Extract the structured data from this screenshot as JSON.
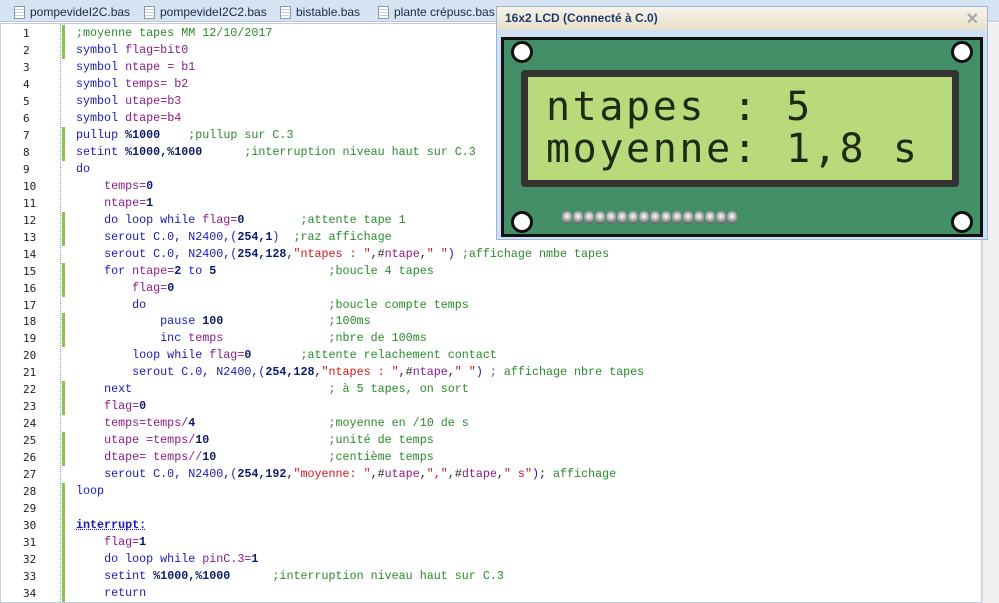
{
  "tabs": [
    {
      "label": "pompevideI2C.bas"
    },
    {
      "label": "pompevideI2C2.bas"
    },
    {
      "label": "bistable.bas"
    },
    {
      "label": "plante crépusc.bas"
    }
  ],
  "editor": {
    "lines": [
      {
        "n": "1",
        "changed": true,
        "t": [
          [
            "c",
            ";moyenne tapes MM 12/10/2017"
          ]
        ]
      },
      {
        "n": "2",
        "changed": true,
        "t": [
          [
            "k",
            "symbol "
          ],
          [
            "v",
            "flag=bit0"
          ]
        ]
      },
      {
        "n": "3",
        "t": [
          [
            "k",
            "symbol "
          ],
          [
            "v",
            "ntape = b1"
          ]
        ]
      },
      {
        "n": "4",
        "t": [
          [
            "k",
            "symbol "
          ],
          [
            "v",
            "temps= b2"
          ]
        ]
      },
      {
        "n": "5",
        "t": [
          [
            "k",
            "symbol "
          ],
          [
            "v",
            "utape=b3"
          ]
        ]
      },
      {
        "n": "6",
        "t": [
          [
            "k",
            "symbol "
          ],
          [
            "v",
            "dtape=b4"
          ]
        ]
      },
      {
        "n": "7",
        "changed": true,
        "t": [
          [
            "k",
            "pullup "
          ],
          [
            "n",
            "%1000"
          ],
          [
            "p",
            "    "
          ],
          [
            "c",
            ";pullup sur C.3"
          ]
        ]
      },
      {
        "n": "8",
        "changed": true,
        "t": [
          [
            "k",
            "setint "
          ],
          [
            "n",
            "%1000,%1000"
          ],
          [
            "p",
            "      "
          ],
          [
            "c",
            ";interruption niveau haut sur C.3"
          ]
        ]
      },
      {
        "n": "9",
        "t": [
          [
            "k",
            "do"
          ]
        ]
      },
      {
        "n": "10",
        "t": [
          [
            "p",
            "    "
          ],
          [
            "v",
            "temps="
          ],
          [
            "n",
            "0"
          ]
        ]
      },
      {
        "n": "11",
        "t": [
          [
            "p",
            "    "
          ],
          [
            "v",
            "ntape="
          ],
          [
            "n",
            "1"
          ]
        ]
      },
      {
        "n": "12",
        "changed": true,
        "t": [
          [
            "p",
            "    "
          ],
          [
            "k",
            "do loop while "
          ],
          [
            "v",
            "flag="
          ],
          [
            "n",
            "0"
          ],
          [
            "p",
            "        "
          ],
          [
            "c",
            ";attente tape 1"
          ]
        ]
      },
      {
        "n": "13",
        "changed": true,
        "t": [
          [
            "p",
            "    "
          ],
          [
            "k",
            "serout C.0, N2400,("
          ],
          [
            "n",
            "254,1"
          ],
          [
            "k",
            ")"
          ],
          [
            "p",
            "  "
          ],
          [
            "c",
            ";raz affichage"
          ]
        ]
      },
      {
        "n": "14",
        "t": [
          [
            "p",
            "    "
          ],
          [
            "k",
            "serout C.0, N2400,("
          ],
          [
            "n",
            "254,128"
          ],
          [
            "p",
            ","
          ],
          [
            "s",
            "\"ntapes : \""
          ],
          [
            "p",
            ",#"
          ],
          [
            "v",
            "ntape"
          ],
          [
            "p",
            ","
          ],
          [
            "s",
            "\" \""
          ],
          [
            "k",
            ")"
          ],
          [
            "p",
            " "
          ],
          [
            "c",
            ";affichage nmbe tapes"
          ]
        ]
      },
      {
        "n": "15",
        "changed": true,
        "t": [
          [
            "p",
            "    "
          ],
          [
            "k",
            "for "
          ],
          [
            "v",
            "ntape="
          ],
          [
            "n",
            "2"
          ],
          [
            "k",
            " to "
          ],
          [
            "n",
            "5"
          ],
          [
            "p",
            "                "
          ],
          [
            "c",
            ";boucle 4 tapes"
          ]
        ]
      },
      {
        "n": "16",
        "changed": true,
        "t": [
          [
            "p",
            "        "
          ],
          [
            "v",
            "flag="
          ],
          [
            "n",
            "0"
          ]
        ]
      },
      {
        "n": "17",
        "t": [
          [
            "p",
            "        "
          ],
          [
            "k",
            "do"
          ],
          [
            "p",
            "                          "
          ],
          [
            "c",
            ";boucle compte temps"
          ]
        ]
      },
      {
        "n": "18",
        "changed": true,
        "t": [
          [
            "p",
            "            "
          ],
          [
            "k",
            "pause "
          ],
          [
            "n",
            "100"
          ],
          [
            "p",
            "               "
          ],
          [
            "c",
            ";100ms"
          ]
        ]
      },
      {
        "n": "19",
        "changed": true,
        "t": [
          [
            "p",
            "            "
          ],
          [
            "k",
            "inc "
          ],
          [
            "v",
            "temps"
          ],
          [
            "p",
            "               "
          ],
          [
            "c",
            ";nbre de 100ms"
          ]
        ]
      },
      {
        "n": "20",
        "t": [
          [
            "p",
            "        "
          ],
          [
            "k",
            "loop while "
          ],
          [
            "v",
            "flag="
          ],
          [
            "n",
            "0"
          ],
          [
            "p",
            "       "
          ],
          [
            "c",
            ";attente relachement contact"
          ]
        ]
      },
      {
        "n": "21",
        "t": [
          [
            "p",
            "        "
          ],
          [
            "k",
            "serout C.0, N2400,("
          ],
          [
            "n",
            "254,128"
          ],
          [
            "p",
            ","
          ],
          [
            "s",
            "\"ntapes : \""
          ],
          [
            "p",
            ",#"
          ],
          [
            "v",
            "ntape"
          ],
          [
            "p",
            ","
          ],
          [
            "s",
            "\" \""
          ],
          [
            "k",
            ")"
          ],
          [
            "p",
            " "
          ],
          [
            "c",
            "; affichage nbre tapes"
          ]
        ]
      },
      {
        "n": "22",
        "changed": true,
        "t": [
          [
            "p",
            "    "
          ],
          [
            "k",
            "next"
          ],
          [
            "p",
            "                            "
          ],
          [
            "c",
            "; à 5 tapes, on sort"
          ]
        ]
      },
      {
        "n": "23",
        "changed": true,
        "t": [
          [
            "p",
            "    "
          ],
          [
            "v",
            "flag="
          ],
          [
            "n",
            "0"
          ]
        ]
      },
      {
        "n": "24",
        "t": [
          [
            "p",
            "    "
          ],
          [
            "v",
            "temps=temps/"
          ],
          [
            "n",
            "4"
          ],
          [
            "p",
            "                   "
          ],
          [
            "c",
            ";moyenne en /10 de s"
          ]
        ]
      },
      {
        "n": "25",
        "changed": true,
        "t": [
          [
            "p",
            "    "
          ],
          [
            "v",
            "utape =temps/"
          ],
          [
            "n",
            "10"
          ],
          [
            "p",
            "                 "
          ],
          [
            "c",
            ";unité de temps"
          ]
        ]
      },
      {
        "n": "26",
        "changed": true,
        "t": [
          [
            "p",
            "    "
          ],
          [
            "v",
            "dtape= temps//"
          ],
          [
            "n",
            "10"
          ],
          [
            "p",
            "                "
          ],
          [
            "c",
            ";centième temps"
          ]
        ]
      },
      {
        "n": "27",
        "t": [
          [
            "p",
            "    "
          ],
          [
            "k",
            "serout C.0, N2400,("
          ],
          [
            "n",
            "254,192"
          ],
          [
            "p",
            ","
          ],
          [
            "s",
            "\"moyenne: \""
          ],
          [
            "p",
            ",#"
          ],
          [
            "v",
            "utape"
          ],
          [
            "p",
            ","
          ],
          [
            "s",
            "\",\""
          ],
          [
            "p",
            ",#"
          ],
          [
            "v",
            "dtape"
          ],
          [
            "p",
            ","
          ],
          [
            "s",
            "\" s\""
          ],
          [
            "k",
            ")"
          ],
          [
            "p",
            "; "
          ],
          [
            "c",
            "affichage"
          ]
        ]
      },
      {
        "n": "28",
        "changed": true,
        "t": [
          [
            "k",
            "loop"
          ]
        ]
      },
      {
        "n": "29",
        "changed": true,
        "t": []
      },
      {
        "n": "30",
        "changed": true,
        "t": [
          [
            "l",
            "interrupt:"
          ]
        ]
      },
      {
        "n": "31",
        "changed": true,
        "t": [
          [
            "p",
            "    "
          ],
          [
            "v",
            "flag="
          ],
          [
            "n",
            "1"
          ]
        ]
      },
      {
        "n": "32",
        "changed": true,
        "t": [
          [
            "p",
            "    "
          ],
          [
            "k",
            "do loop while "
          ],
          [
            "v",
            "pinC.3="
          ],
          [
            "n",
            "1"
          ]
        ]
      },
      {
        "n": "33",
        "changed": true,
        "t": [
          [
            "p",
            "    "
          ],
          [
            "k",
            "setint "
          ],
          [
            "n",
            "%1000,%1000"
          ],
          [
            "p",
            "      "
          ],
          [
            "c",
            ";interruption niveau haut sur C.3"
          ]
        ]
      },
      {
        "n": "34",
        "changed": true,
        "t": [
          [
            "p",
            "    "
          ],
          [
            "k",
            "return"
          ]
        ]
      }
    ]
  },
  "lcd": {
    "title": "16x2 LCD (Connecté à C.0)",
    "close_icon": "close-icon",
    "row1": "ntapes : 5",
    "row2": "moyenne: 1,8 s",
    "screen_color": "#b8da7a",
    "board_color": "#428f68"
  }
}
